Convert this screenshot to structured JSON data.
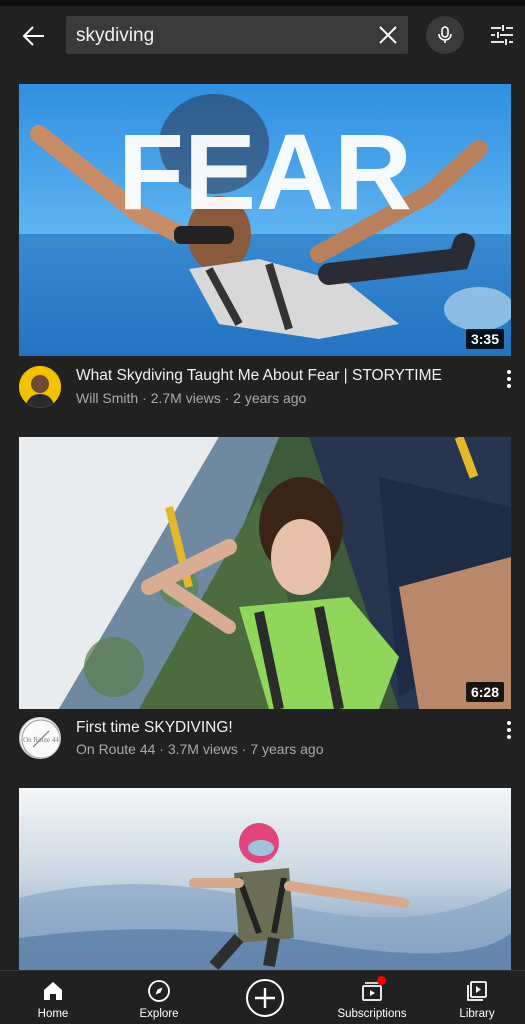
{
  "search": {
    "query": "skydiving"
  },
  "icons": {
    "back": "arrow-left-icon",
    "clear": "close-icon",
    "mic": "microphone-icon",
    "filter": "sliders-icon",
    "more": "more-vertical-icon"
  },
  "videos": [
    {
      "thumb_text": "FEAR",
      "duration": "3:35",
      "title": "What Skydiving Taught Me About Fear | STORYTIME",
      "channel": "Will Smith",
      "views": "2.7M views",
      "age": "2 years ago"
    },
    {
      "duration": "6:28",
      "title": "First time SKYDIVING!",
      "channel": "On Route 44",
      "avatar_text": "On Route 44",
      "views": "3.7M views",
      "age": "7 years ago"
    },
    {}
  ],
  "separator": " · ",
  "nav": [
    {
      "label": "Home",
      "icon": "home-icon"
    },
    {
      "label": "Explore",
      "icon": "compass-icon"
    },
    {
      "label": "",
      "icon": "plus-circle-icon"
    },
    {
      "label": "Subscriptions",
      "icon": "subscriptions-icon"
    },
    {
      "label": "Library",
      "icon": "library-icon"
    }
  ],
  "colors": {
    "background": "#212121",
    "accent": "#ff0000",
    "meta_text": "#aaaaaa"
  }
}
